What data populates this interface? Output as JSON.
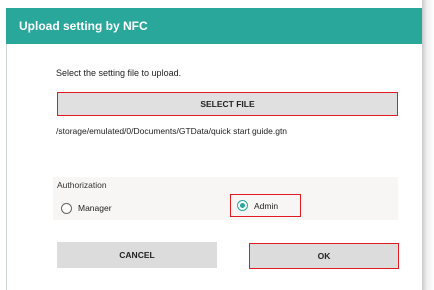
{
  "dialog": {
    "title": "Upload setting by NFC",
    "prompt": "Select the setting file to upload.",
    "select_file_label": "SELECT FILE",
    "file_path": "/storage/emulated/0/Documents/GTData/quick start guide.gtn",
    "authorization": {
      "label": "Authorization",
      "options": [
        {
          "label": "Manager",
          "checked": false
        },
        {
          "label": "Admin",
          "checked": true
        }
      ]
    },
    "cancel_label": "CANCEL",
    "ok_label": "OK"
  },
  "colors": {
    "title_bar": "#2aa79b",
    "highlight": "#e11b22",
    "button": "#e0e0e0"
  }
}
